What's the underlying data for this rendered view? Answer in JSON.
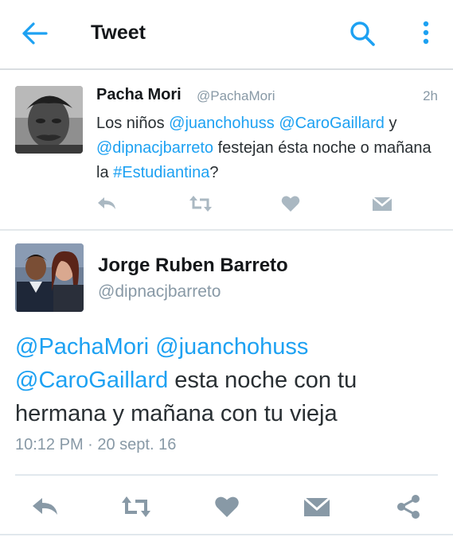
{
  "header": {
    "title": "Tweet",
    "back_icon": "arrow-left-icon",
    "search_icon": "search-icon",
    "menu_icon": "more-vertical-icon",
    "accent_color": "#1da1f2"
  },
  "parent_tweet": {
    "name": "Pacha Mori",
    "handle": "@PachaMori",
    "time": "2h",
    "text_parts": {
      "p1": "Los niños ",
      "m1": "@juanchohuss",
      "p2": " ",
      "m2": "@CaroGaillard",
      "p3": " y ",
      "m3": "@dipnacjbarreto",
      "p4": " festejan ésta noche o mañana la ",
      "h1": "#Estudiantina",
      "p5": "?"
    },
    "actions": [
      "reply-icon",
      "retweet-icon",
      "like-icon",
      "dm-icon"
    ]
  },
  "main_tweet": {
    "name": "Jorge Ruben Barreto",
    "handle": "@dipnacjbarreto",
    "text_parts": {
      "m1": "@PachaMori",
      "p1": " ",
      "m2": "@juanchohuss",
      "p2": " ",
      "m3": "@CaroGaillard",
      "p3": " esta noche con tu hermana y mañana con tu vieja"
    },
    "timestamp": "10:12 PM · 20 sept. 16",
    "actions": [
      "reply-icon",
      "retweet-icon",
      "like-icon",
      "dm-icon",
      "share-icon"
    ]
  },
  "colors": {
    "link": "#1da1f2",
    "muted": "#8899a6",
    "icon_gray": "#aab8c2"
  }
}
